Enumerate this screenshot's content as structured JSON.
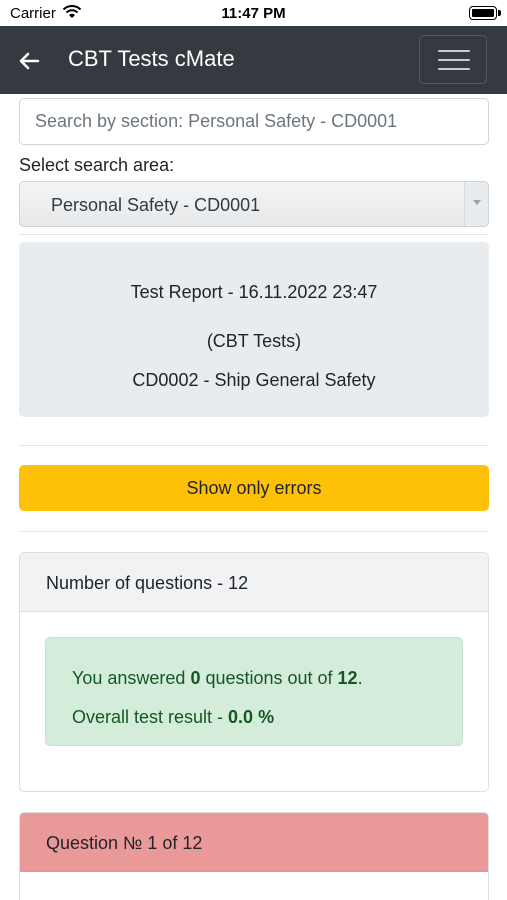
{
  "status_bar": {
    "carrier": "Carrier",
    "time": "11:47 PM"
  },
  "navbar": {
    "title": "CBT Tests cMate"
  },
  "search": {
    "placeholder": "Search by section: Personal Safety - CD0001"
  },
  "search_area": {
    "label": "Select search area:",
    "selected": "Personal Safety - CD0001"
  },
  "report": {
    "title": "Test Report - 16.11.2022 23:47",
    "subtitle": "(CBT Tests)",
    "section": "CD0002 - Ship General Safety"
  },
  "errors_button": {
    "label": "Show only errors"
  },
  "summary": {
    "header": "Number of questions - 12",
    "answered_prefix": "You answered ",
    "answered_count": "0",
    "answered_mid": " questions out of ",
    "total": "12",
    "answered_suffix": ".",
    "result_prefix": "Overall test result - ",
    "result_value": "0.0 %"
  },
  "question": {
    "header": "Question № 1 of 12"
  },
  "colors": {
    "navbar": "#343a40",
    "warning": "#ffc107",
    "success_bg": "#d4edda",
    "danger_bg": "#ea9999"
  }
}
